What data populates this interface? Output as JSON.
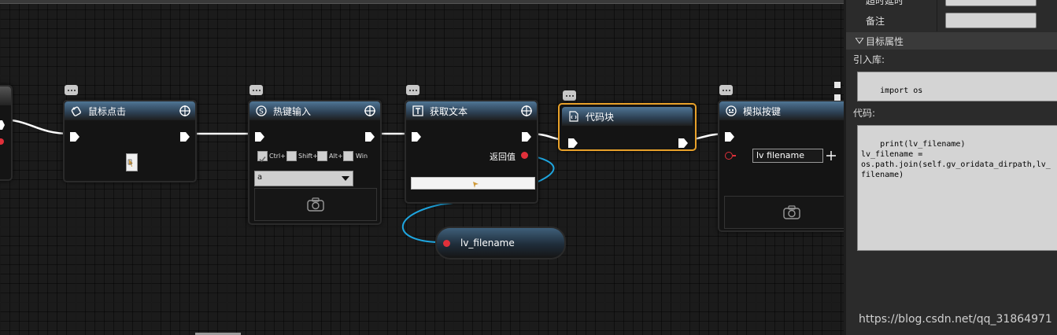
{
  "nodes": {
    "mouse_click": {
      "title": "鼠标点击"
    },
    "hotkey": {
      "title": "热键输入",
      "checkboxes": [
        {
          "label": "Ctrl+",
          "checked": true
        },
        {
          "label": "Shift+",
          "checked": false
        },
        {
          "label": "Alt+",
          "checked": false
        },
        {
          "label": "Win",
          "checked": false
        }
      ],
      "key_value": "a"
    },
    "get_text": {
      "title": "获取文本",
      "output_label": "返回值"
    },
    "code_block": {
      "title": "代码块"
    },
    "simulate_key": {
      "title": "模拟按键",
      "input_value": "lv filename"
    },
    "variable": {
      "name": "lv_filename"
    }
  },
  "panel": {
    "partial_label_top": "超时延时",
    "note_label": "备注",
    "section_title": "目标属性",
    "import_label": "引入库:",
    "import_value": "import os",
    "code_label": "代码:",
    "code_value": "print(lv_filename)\nlv_filename =\nos.path.join(self.gv_oridata_dirpath,lv_filename)"
  },
  "watermark": "https://blog.csdn.net/qq_31864971",
  "colors": {
    "accent": "#e8a12a",
    "wire_exec": "#ffffff",
    "wire_data": "#1ea6e0",
    "pin_data": "#e0303a"
  }
}
